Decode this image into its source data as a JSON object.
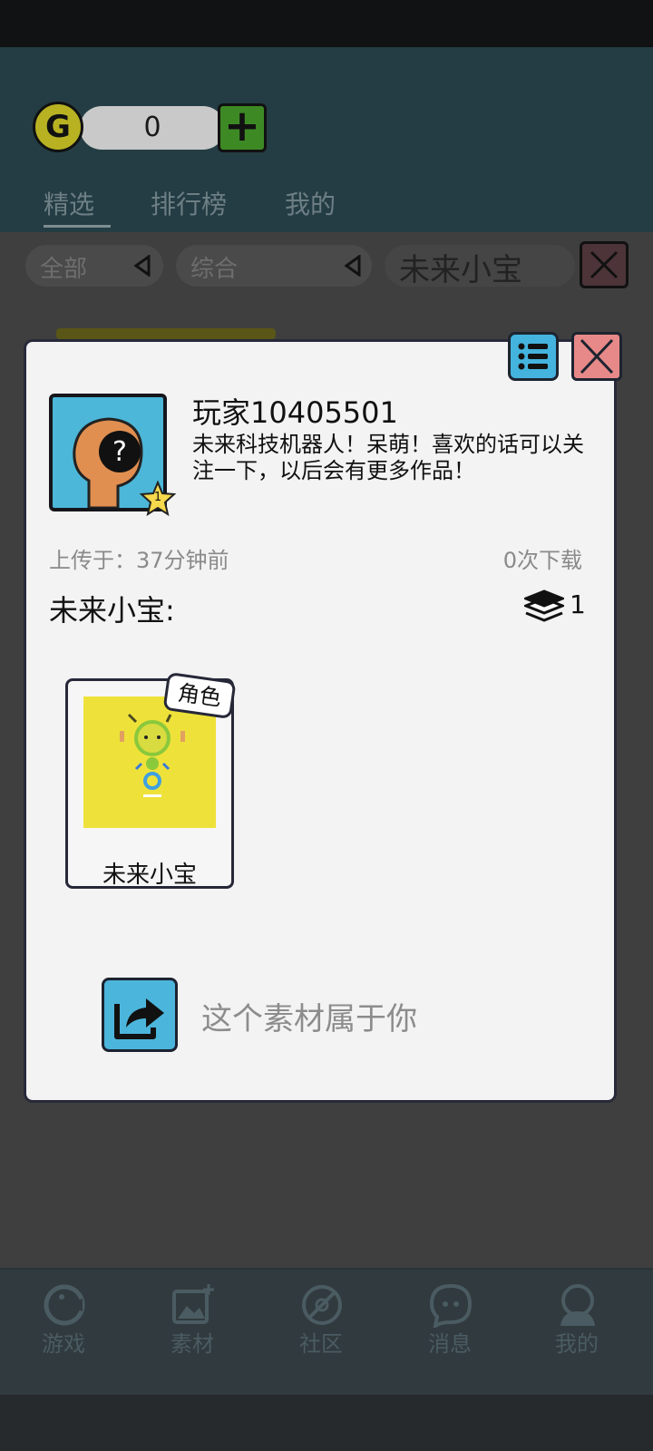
{
  "currency": {
    "icon": "g-coin-icon",
    "letter": "G",
    "value": "0",
    "add_label": "+"
  },
  "tabs": [
    {
      "label": "精选",
      "active": true
    },
    {
      "label": "排行榜",
      "active": false
    },
    {
      "label": "我的",
      "active": false
    }
  ],
  "filters": {
    "category": "全部",
    "sort": "综合",
    "search_query": "未来小宝"
  },
  "modal": {
    "username": "玩家10405501",
    "level_badge": "1",
    "bio": "未来科技机器人！呆萌！喜欢的话可以关注一下，以后会有更多作品！",
    "uploaded": "上传于：37分钟前",
    "downloads": "0次下载",
    "asset_title": "未来小宝:",
    "layer_count": "1",
    "card": {
      "badge": "角色",
      "label": "未来小宝"
    },
    "ownership_text": "这个素材属于你"
  },
  "nav": [
    {
      "label": "游戏",
      "icon": "game-icon"
    },
    {
      "label": "素材",
      "icon": "image-add-icon"
    },
    {
      "label": "社区",
      "icon": "compass-icon"
    },
    {
      "label": "消息",
      "icon": "chat-icon"
    },
    {
      "label": "我的",
      "icon": "profile-icon"
    }
  ],
  "colors": {
    "header": "#243d44",
    "overlay": "#3f3f3f",
    "modal_bg": "#f3f3f3",
    "accent_blue": "#4cb5dc",
    "close_red": "#e78988",
    "card_yellow": "#eee23a"
  }
}
